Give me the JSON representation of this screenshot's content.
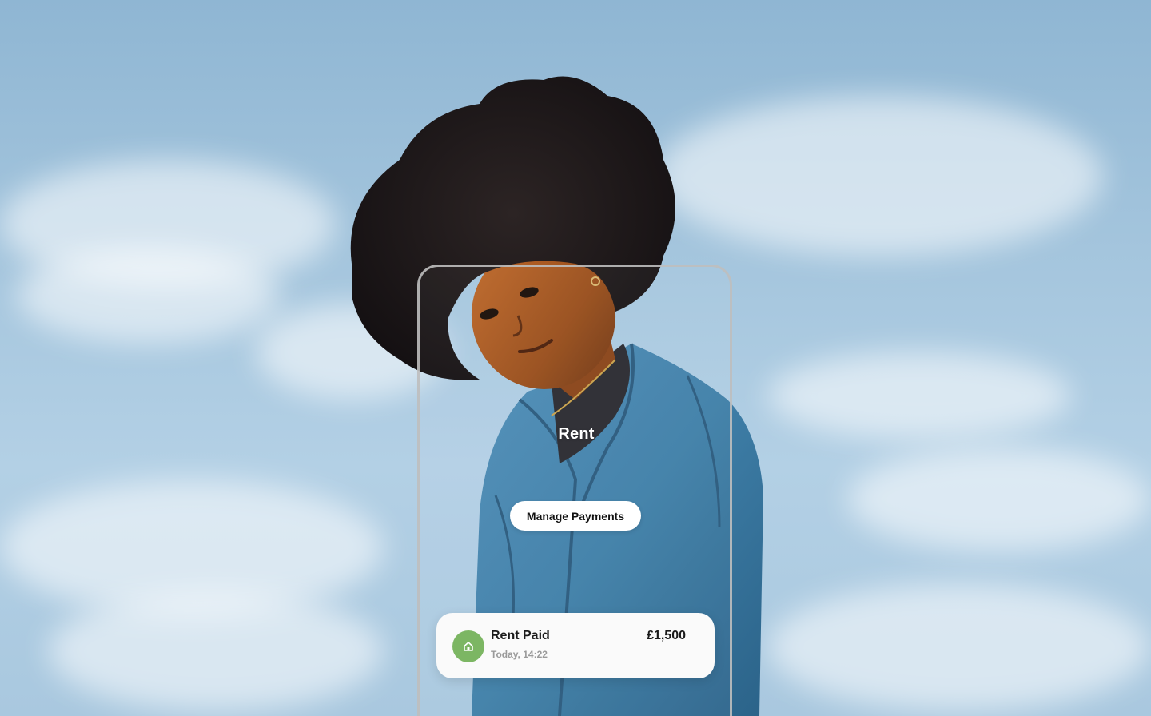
{
  "screen": {
    "title": "Rent",
    "manage_button_label": "Manage Payments"
  },
  "payment": {
    "title": "Rent Paid",
    "time": "Today, 14:22",
    "amount": "£1,500",
    "icon": "home-icon",
    "icon_color": "#7cb663"
  },
  "colors": {
    "sky": "#a4c5dd",
    "jacket": "#3f7fa8"
  }
}
